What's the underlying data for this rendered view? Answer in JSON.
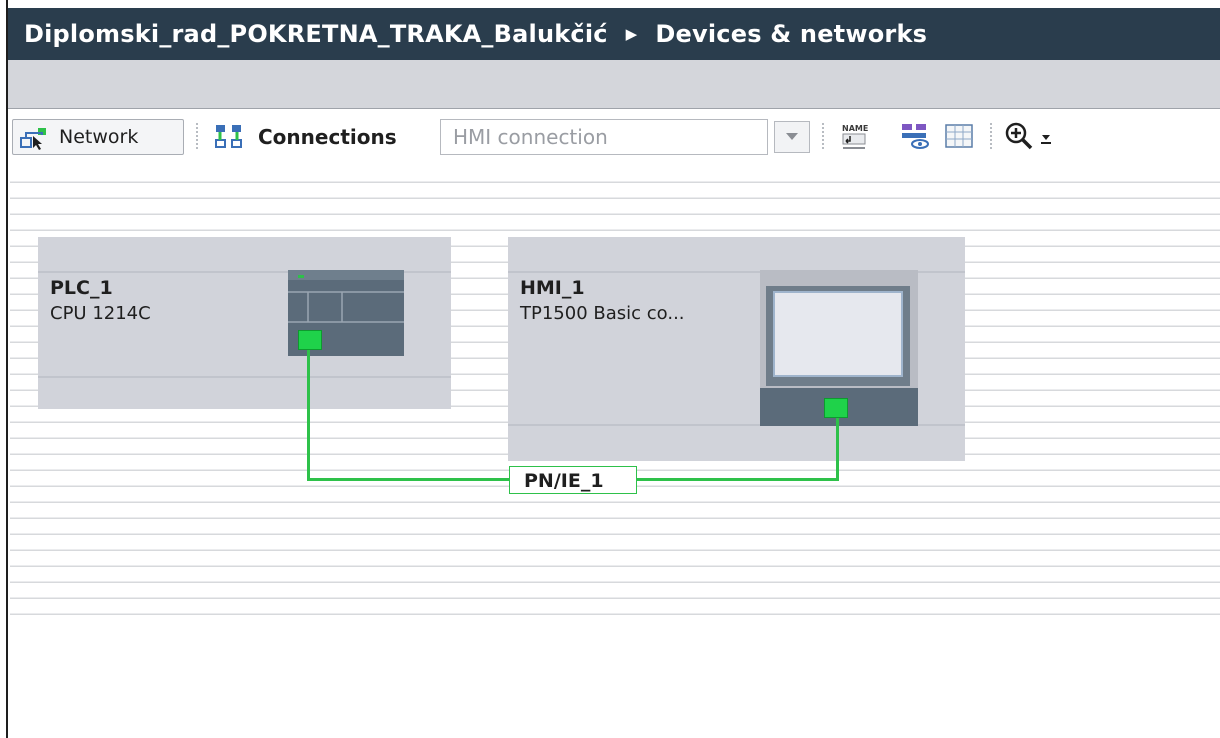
{
  "window": {
    "project": "Diplomski_rad_POKRETNA_TRAKA_Balukčić",
    "separator_icon": "breadcrumb-arrow-icon",
    "view": "Devices & networks"
  },
  "toolbar": {
    "network_label": "Network",
    "connections_label": "Connections",
    "connection_type": {
      "value": "HMI connection"
    },
    "icons": [
      "network-icon",
      "connections-icon",
      "name-icon",
      "show-address-icon",
      "table-view-icon",
      "zoom-in-icon",
      "dropdown-arrow-icon"
    ]
  },
  "devices": [
    {
      "name": "PLC_1",
      "type": "CPU 1214C",
      "icon": "plc-cpu-icon"
    },
    {
      "name": "HMI_1",
      "type": "TP1500 Basic co...",
      "icon": "hmi-panel-icon"
    }
  ],
  "network": {
    "label": "PN/IE_1"
  },
  "colors": {
    "title_bg": "#2a3d4d",
    "wire": "#2ec14a",
    "port": "#1fd24a",
    "device_bg": "#d1d3da"
  }
}
